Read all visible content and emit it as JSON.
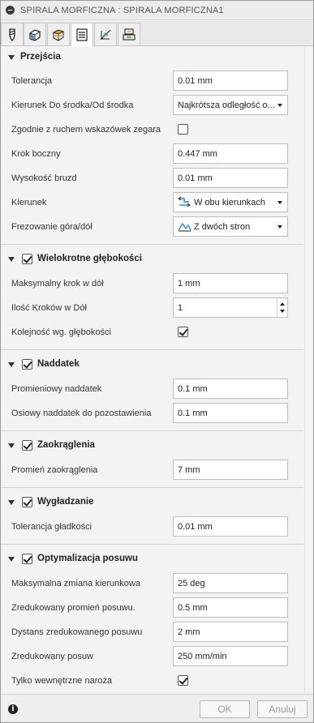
{
  "window": {
    "title": "SPIRALA MORFICZNA : SPIRALA MORFICZNA1"
  },
  "tabs": [
    {
      "icon": "tool-icon"
    },
    {
      "icon": "geometry-icon"
    },
    {
      "icon": "heights-icon"
    },
    {
      "icon": "passes-icon"
    },
    {
      "icon": "linking-icon"
    },
    {
      "icon": "shaft-holder-icon"
    }
  ],
  "sections": {
    "przejscia": {
      "title": "Przejścia",
      "tolerancja": {
        "label": "Tolerancja",
        "value": "0.01 mm"
      },
      "kierunek_do": {
        "label": "Kierunek Do środka/Od środka",
        "value": "Najkrótsza odległość o..."
      },
      "zgodnie": {
        "label": "Zgodnie z ruchem wskazówek zegara",
        "checked": false
      },
      "krok_boczny": {
        "label": "Krok boczny",
        "value": "0.447 mm"
      },
      "wysokosc_bruzd": {
        "label": "Wysokość bruzd",
        "value": "0.01 mm"
      },
      "kierunek": {
        "label": "Kierunek",
        "value": "W obu kierunkach",
        "icon": "both-directions-icon"
      },
      "frezowanie": {
        "label": "Frezowanie góra/dół",
        "value": "Z dwóch stron",
        "icon": "up-down-milling-icon"
      }
    },
    "wielokrotne": {
      "title": "Wielokrotne głębokości",
      "checked": true,
      "maks_krok": {
        "label": "Maksymalny krok w dół",
        "value": "1 mm"
      },
      "ilosc_krokow": {
        "label": "Ilość Kroków w Dół",
        "value": "1"
      },
      "kolejnosc": {
        "label": "Kolejność wg. głębokości",
        "checked": true
      }
    },
    "naddatek": {
      "title": "Naddatek",
      "checked": true,
      "promieniowy": {
        "label": "Promieniowy naddatek",
        "value": "0.1 mm"
      },
      "osiowy": {
        "label": "Osiowy naddatek do pozostawienia",
        "value": "0.1 mm"
      }
    },
    "zaokraglenia": {
      "title": "Zaokrąglenia",
      "checked": true,
      "promien": {
        "label": "Promień zaokrąglenia",
        "value": "7 mm"
      }
    },
    "wygladzanie": {
      "title": "Wygładzanie",
      "checked": true,
      "tolerancja_gladkosci": {
        "label": "Tolerancja gładkości",
        "value": "0.01 mm"
      }
    },
    "optymalizacja": {
      "title": "Optymalizacja posuwu",
      "checked": true,
      "maks_zmiana": {
        "label": "Maksymalna zmiana kierunkowa",
        "value": "25 deg"
      },
      "zredukowany_promien": {
        "label": "Zredukowany promień posuwu.",
        "value": "0.5 mm"
      },
      "dystans": {
        "label": "Dystans zredukowanego posuwu",
        "value": "2 mm"
      },
      "zredukowany_posuw": {
        "label": "Zredukowany posuw",
        "value": "250 mm/min"
      },
      "tylko_wewnetrzne": {
        "label": "Tylko wewnętrzne naroża",
        "checked": true
      }
    }
  },
  "footer": {
    "info_glyph": "i",
    "ok_label": "OK",
    "cancel_label": "Anuluj"
  }
}
